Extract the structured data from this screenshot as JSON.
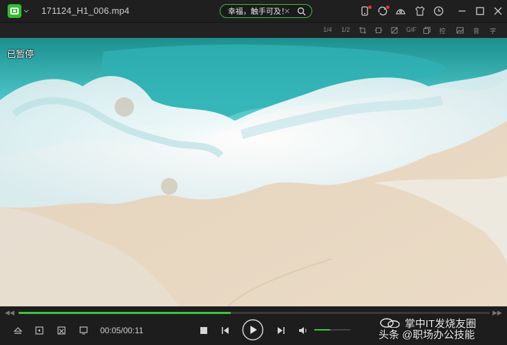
{
  "window": {
    "title": "171124_H1_006.mp4",
    "search_query": "幸福，触手可及！"
  },
  "toolbar": {
    "icons": [
      "phone-icon",
      "cloud-sync-icon",
      "skin-icon",
      "shirt-icon",
      "history-icon",
      "minimize-icon",
      "maximize-icon",
      "close-icon"
    ]
  },
  "subbar": {
    "items": [
      "1/4",
      "1/2",
      "GIF",
      "控",
      "音",
      "字"
    ]
  },
  "video": {
    "status_label": "已暂停"
  },
  "controls": {
    "time": "00:05/00:11",
    "progress": 0.45,
    "volume": 0.45
  },
  "watermark": {
    "line1": "掌中IT发烧友圈",
    "line2": "头条 @职场办公技能"
  },
  "colors": {
    "accent": "#3cc63c",
    "notification": "#e8342d"
  }
}
